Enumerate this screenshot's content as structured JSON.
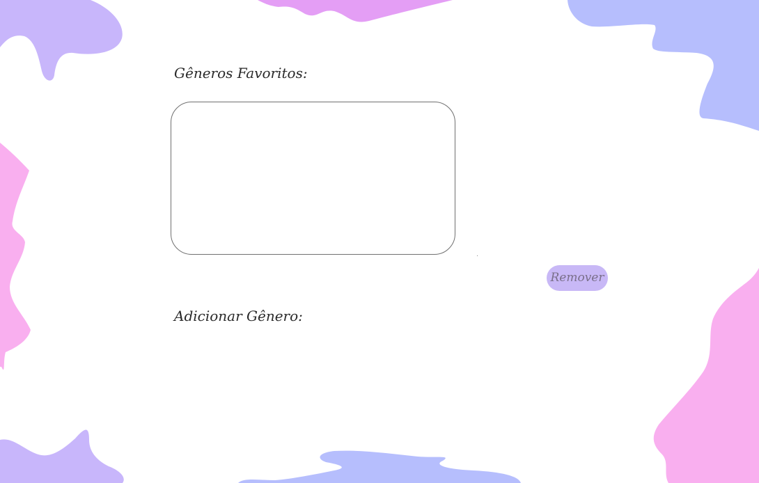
{
  "favorites": {
    "label": "Gêneros Favoritos:",
    "items": []
  },
  "actions": {
    "remove_label": "Remover"
  },
  "add": {
    "label": "Adicionar Gênero:"
  },
  "colors": {
    "background": "#ffffff",
    "blob_lavender": "#c8b6fb",
    "blob_periwinkle": "#b6befd",
    "blob_pink": "#f9afef",
    "blob_magenta": "#e49ef5",
    "button_bg": "#c8b8f6",
    "button_text": "#7a6f8a",
    "text": "#2a2a2a",
    "border": "#6f6f6f"
  }
}
